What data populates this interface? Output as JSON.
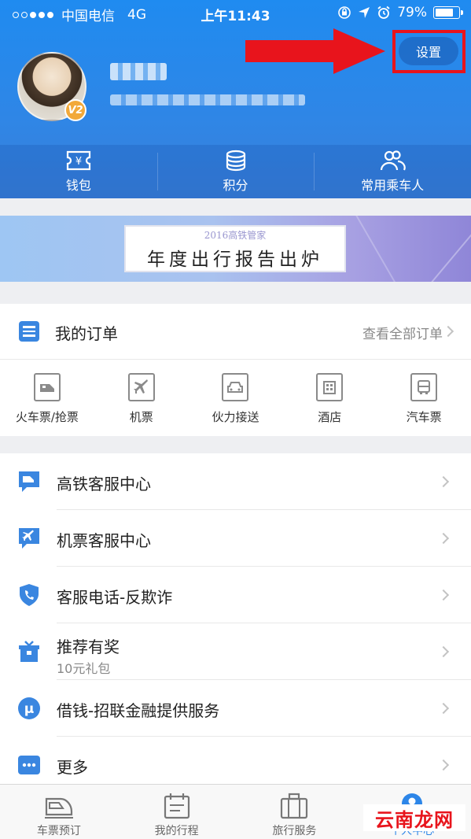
{
  "status_bar": {
    "carrier": "中国电信",
    "network": "4G",
    "time": "上午11:43",
    "battery_percent": "79%",
    "battery_level": 0.79
  },
  "header": {
    "settings_label": "设置",
    "vip_level": "V2",
    "accent_color": "#2d86e8",
    "annotation_color": "#e8141c"
  },
  "quickbar": [
    {
      "icon": "ticket-yuan-icon",
      "label": "钱包"
    },
    {
      "icon": "coins-stack-icon",
      "label": "积分"
    },
    {
      "icon": "passengers-icon",
      "label": "常用乘车人"
    }
  ],
  "banner": {
    "subtitle": "2016高铁管家",
    "title": "年度出行报告出炉"
  },
  "orders": {
    "title": "我的订单",
    "view_all": "查看全部订单",
    "items": [
      {
        "icon": "train-ticket-icon",
        "label": "火车票/抢票"
      },
      {
        "icon": "plane-ticket-icon",
        "label": "机票"
      },
      {
        "icon": "car-ticket-icon",
        "label": "伙力接送"
      },
      {
        "icon": "hotel-ticket-icon",
        "label": "酒店"
      },
      {
        "icon": "bus-ticket-icon",
        "label": "汽车票"
      }
    ]
  },
  "menu": [
    {
      "icon": "train-chat-icon",
      "label": "高铁客服中心",
      "sub": ""
    },
    {
      "icon": "plane-chat-icon",
      "label": "机票客服中心",
      "sub": ""
    },
    {
      "icon": "shield-phone-icon",
      "label": "客服电话-反欺诈",
      "sub": ""
    },
    {
      "icon": "gift-icon",
      "label": "推荐有奖",
      "sub": "10元礼包"
    },
    {
      "icon": "mu-finance-icon",
      "label": "借钱-招联金融提供服务",
      "sub": ""
    },
    {
      "icon": "more-dots-icon",
      "label": "更多",
      "sub": ""
    }
  ],
  "tabbar": [
    {
      "icon": "train-icon",
      "label": "车票预订",
      "active": false
    },
    {
      "icon": "calendar-icon",
      "label": "我的行程",
      "active": false
    },
    {
      "icon": "suitcase-icon",
      "label": "旅行服务",
      "active": false
    },
    {
      "icon": "person-icon",
      "label": "个人中心",
      "active": true
    }
  ],
  "watermark": {
    "part1": "云南",
    "part2": "龙网"
  }
}
